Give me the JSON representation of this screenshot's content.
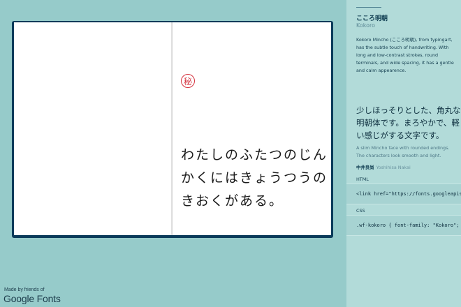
{
  "book": {
    "seal_char": "秘",
    "poem_lines": [
      "わたしのふたつのじん",
      "かくにはきょうつうの",
      "きおくがある。"
    ]
  },
  "credit": {
    "made_by": "Made by friends of",
    "logo_text": "Google Fonts"
  },
  "sidebar": {
    "font_name": "こころ明朝",
    "font_name_latin": "Kokoro",
    "description": "Kokoro Mincho (こころ明朝), from typingart, has the subtle touch of handwriting. With long and low-contrast strokes, round terminals, and wide spacing, it has a gentle and calm appearence.",
    "jp_sample": "少しほっそりとした、角丸な明朝体です。まろやかで、軽い感じがする文字です。",
    "en_sample": "A slim Mincho face with rounded endings. The characters look smooth and light.",
    "designer_jp": "中井良尚",
    "designer_latin": "Yoshihisa Nakai",
    "html_label": "HTML",
    "html_code": "<link href=\"https://fonts.googleapis.com/earlyaccess/kokoro.css\" rel=\"stylesheet\">",
    "css_label": "CSS",
    "css_code": ".wf-kokoro { font-family: \"Kokoro\"; }"
  }
}
